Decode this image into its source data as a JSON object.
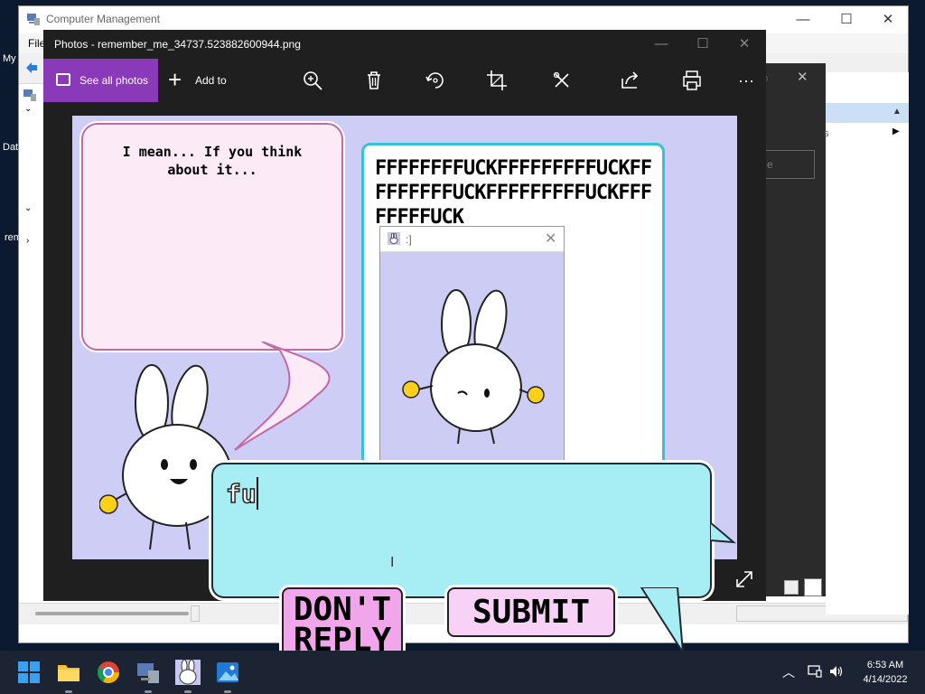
{
  "computer_management": {
    "title": "Computer Management",
    "menu_file": "File",
    "side_text_1": "My",
    "side_text_2": "Dat",
    "side_text_3": "rem",
    "minimize": "—",
    "maximize": "☐",
    "close": "✕",
    "right_text": "s",
    "field_text": "e"
  },
  "photos": {
    "title": "Photos - remember_me_34737.523882600944.png",
    "minimize": "—",
    "maximize": "☐",
    "close": "✕",
    "see_all_label": "See all photos",
    "add_to_label": "Add to",
    "toolbar_icons": [
      "zoom-in-icon",
      "delete-icon",
      "rotate-icon",
      "crop-icon",
      "edit-icon",
      "share-icon",
      "print-icon",
      "more-icon"
    ],
    "more_label": "···",
    "accent_color": "#8a3ab8"
  },
  "image_content": {
    "left_bubble_text": "I mean... If you think about it...",
    "right_bubble_text": "FFFFFFFFUCKFFFFFFFFFUCKFFFFFFFFFUCKFFFFFFFFFUCKFFFFFFFFUCK"
  },
  "mini_window": {
    "title": ":]",
    "close": "✕"
  },
  "reply": {
    "input_value": "fu",
    "dont_reply_label": "DON'T REPLY",
    "submit_label": "SUBMIT"
  },
  "taskbar": {
    "apps": [
      "start-icon",
      "file-explorer-icon",
      "chrome-icon",
      "computer-management-icon",
      "bunny-app-icon",
      "photos-icon"
    ],
    "tray_chevron": "︿",
    "time": "6:53 AM",
    "date": "4/14/2022"
  }
}
